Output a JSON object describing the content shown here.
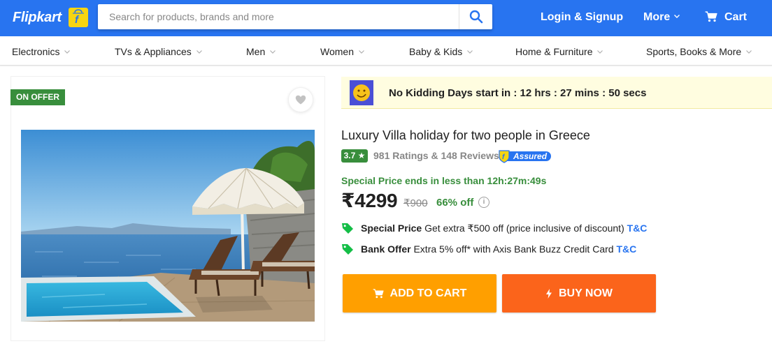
{
  "header": {
    "logo_text": "Flipkart",
    "search_placeholder": "Search for products, brands and more",
    "login_label": "Login & Signup",
    "more_label": "More",
    "cart_label": "Cart",
    "brand_color": "#2874f0",
    "icons": [
      "search-icon",
      "chevron-down-icon",
      "cart-icon",
      "flipkart-logo-icon"
    ]
  },
  "categories": [
    "Electronics",
    "TVs & Appliances",
    "Men",
    "Women",
    "Baby & Kids",
    "Home & Furniture",
    "Sports, Books & More"
  ],
  "product": {
    "offer_tag": "ON OFFER",
    "banner_text": "No Kidding Days start in : 12 hrs : 27 mins : 50 secs",
    "title": "Luxury Villa holiday for two people in Greece",
    "rating": "3.7 ★",
    "ratings_reviews": "981 Ratings & 148 Reviews",
    "assured_label": "Assured",
    "special_price_line": "Special Price ends in less than 12h:27m:49s",
    "price": "₹4299",
    "mrp": "₹900",
    "discount": "66% off",
    "info_icon": "i",
    "offers": [
      {
        "label": "Special Price",
        "text": "Get extra ₹500 off (price inclusive of discount)",
        "tnc": "T&C"
      },
      {
        "label": "Bank Offer",
        "text": "Extra 5% off* with Axis Bank Buzz Credit Card",
        "tnc": "T&C"
      }
    ],
    "add_to_cart": "ADD TO CART",
    "buy_now": "BUY NOW",
    "colors": {
      "offer_green": "#388e3c",
      "cart_orange": "#ff9f00",
      "buy_orange": "#fb641b"
    }
  }
}
